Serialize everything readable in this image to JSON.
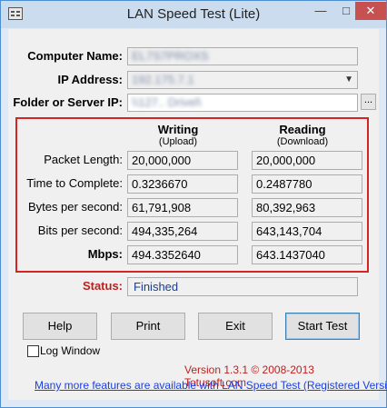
{
  "window": {
    "title": "LAN Speed Test (Lite)"
  },
  "controls": {
    "minimize": "—",
    "maximize": "□",
    "close": "✕"
  },
  "form": {
    "computer_name_label": "Computer Name:",
    "computer_name_value": "EL7S7PROXS",
    "ip_label": "IP Address:",
    "ip_value": "192.175.7.1",
    "folder_label": "Folder or Server IP:",
    "folder_value": "\\\\127.. Drivel\\",
    "browse_label": "..."
  },
  "results": {
    "writing_header": "Writing",
    "writing_sub": "(Upload)",
    "reading_header": "Reading",
    "reading_sub": "(Download)",
    "rows": [
      {
        "label": "Packet Length:",
        "write": "20,000,000",
        "read": "20,000,000"
      },
      {
        "label": "Time to Complete:",
        "write": "0.3236670",
        "read": "0.2487780"
      },
      {
        "label": "Bytes per second:",
        "write": "61,791,908",
        "read": "80,392,963"
      },
      {
        "label": "Bits per second:",
        "write": "494,335,264",
        "read": "643,143,704"
      },
      {
        "label": "Mbps:",
        "write": "494.3352640",
        "read": "643.1437040"
      }
    ]
  },
  "status": {
    "label": "Status:",
    "value": "Finished",
    "label_color": "#c01e1e"
  },
  "buttons": {
    "help": "Help",
    "print": "Print",
    "exit": "Exit",
    "start": "Start Test"
  },
  "log_window": {
    "label": "Log Window",
    "checked": false
  },
  "footer": {
    "version": "Version 1.3.1 © 2008-2013 Totusoft.com",
    "link": "Many more features are available with LAN Speed Test (Registered Version)"
  }
}
